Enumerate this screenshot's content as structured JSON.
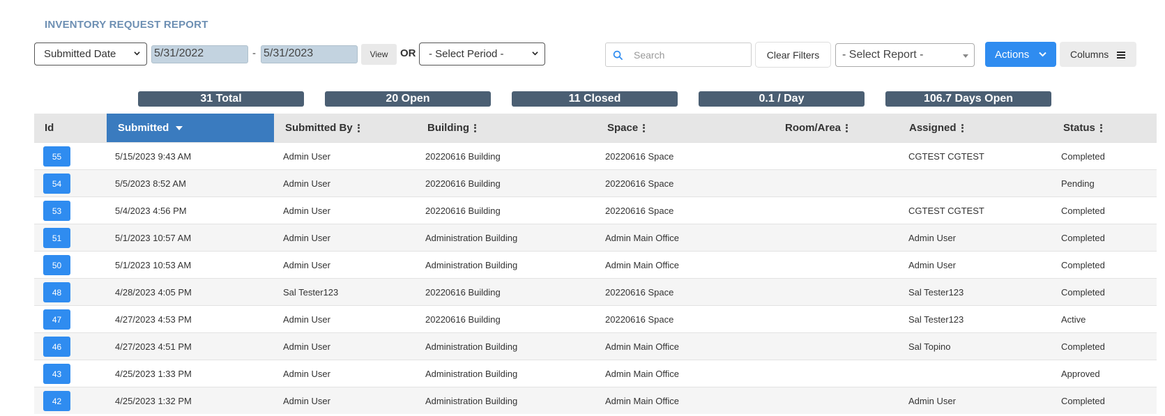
{
  "page": {
    "title": "INVENTORY REQUEST REPORT"
  },
  "filters": {
    "date_field": "Submitted Date",
    "start_date": "5/31/2022",
    "date_separator": "-",
    "end_date": "5/31/2023",
    "view_label": "View",
    "or_label": "OR",
    "period_placeholder": "- Select Period -",
    "search_placeholder": "Search",
    "clear_label": "Clear Filters",
    "report_placeholder": "- Select Report -",
    "actions_label": "Actions",
    "columns_label": "Columns"
  },
  "stats": [
    {
      "label": "31 Total"
    },
    {
      "label": "20 Open"
    },
    {
      "label": "11 Closed"
    },
    {
      "label": "0.1 / Day"
    },
    {
      "label": "106.7 Days Open"
    }
  ],
  "table": {
    "headers": {
      "id": "Id",
      "submitted": "Submitted",
      "submitted_by": "Submitted By",
      "building": "Building",
      "space": "Space",
      "room": "Room/Area",
      "assigned": "Assigned",
      "status": "Status"
    },
    "rows": [
      {
        "id": "55",
        "submitted": "5/15/2023 9:43 AM",
        "submitted_by": "Admin User",
        "building": "20220616 Building",
        "space": "20220616 Space",
        "room": "",
        "assigned": "CGTEST CGTEST",
        "status": "Completed"
      },
      {
        "id": "54",
        "submitted": "5/5/2023 8:52 AM",
        "submitted_by": "Admin User",
        "building": "20220616 Building",
        "space": "20220616 Space",
        "room": "",
        "assigned": "",
        "status": "Pending"
      },
      {
        "id": "53",
        "submitted": "5/4/2023 4:56 PM",
        "submitted_by": "Admin User",
        "building": "20220616 Building",
        "space": "20220616 Space",
        "room": "",
        "assigned": "CGTEST CGTEST",
        "status": "Completed"
      },
      {
        "id": "51",
        "submitted": "5/1/2023 10:57 AM",
        "submitted_by": "Admin User",
        "building": "Administration Building",
        "space": "Admin Main Office",
        "room": "",
        "assigned": "Admin User",
        "status": "Completed"
      },
      {
        "id": "50",
        "submitted": "5/1/2023 10:53 AM",
        "submitted_by": "Admin User",
        "building": "Administration Building",
        "space": "Admin Main Office",
        "room": "",
        "assigned": "Admin User",
        "status": "Completed"
      },
      {
        "id": "48",
        "submitted": "4/28/2023 4:05 PM",
        "submitted_by": "Sal Tester123",
        "building": "20220616 Building",
        "space": "20220616 Space",
        "room": "",
        "assigned": "Sal Tester123",
        "status": "Completed"
      },
      {
        "id": "47",
        "submitted": "4/27/2023 4:53 PM",
        "submitted_by": "Admin User",
        "building": "20220616 Building",
        "space": "20220616 Space",
        "room": "",
        "assigned": "Sal Tester123",
        "status": "Active"
      },
      {
        "id": "46",
        "submitted": "4/27/2023 4:51 PM",
        "submitted_by": "Admin User",
        "building": "Administration Building",
        "space": "Admin Main Office",
        "room": "",
        "assigned": "Sal Topino",
        "status": "Completed"
      },
      {
        "id": "43",
        "submitted": "4/25/2023 1:33 PM",
        "submitted_by": "Admin User",
        "building": "Administration Building",
        "space": "Admin Main Office",
        "room": "",
        "assigned": "",
        "status": "Approved"
      },
      {
        "id": "42",
        "submitted": "4/25/2023 1:32 PM",
        "submitted_by": "Admin User",
        "building": "Administration Building",
        "space": "Admin Main Office",
        "room": "",
        "assigned": "Admin User",
        "status": "Completed"
      }
    ]
  },
  "colors": {
    "accent": "#2f8cf0",
    "sorted_header": "#3a7bbf",
    "stat_badge": "#4b5f73",
    "title": "#6d8fb3"
  }
}
